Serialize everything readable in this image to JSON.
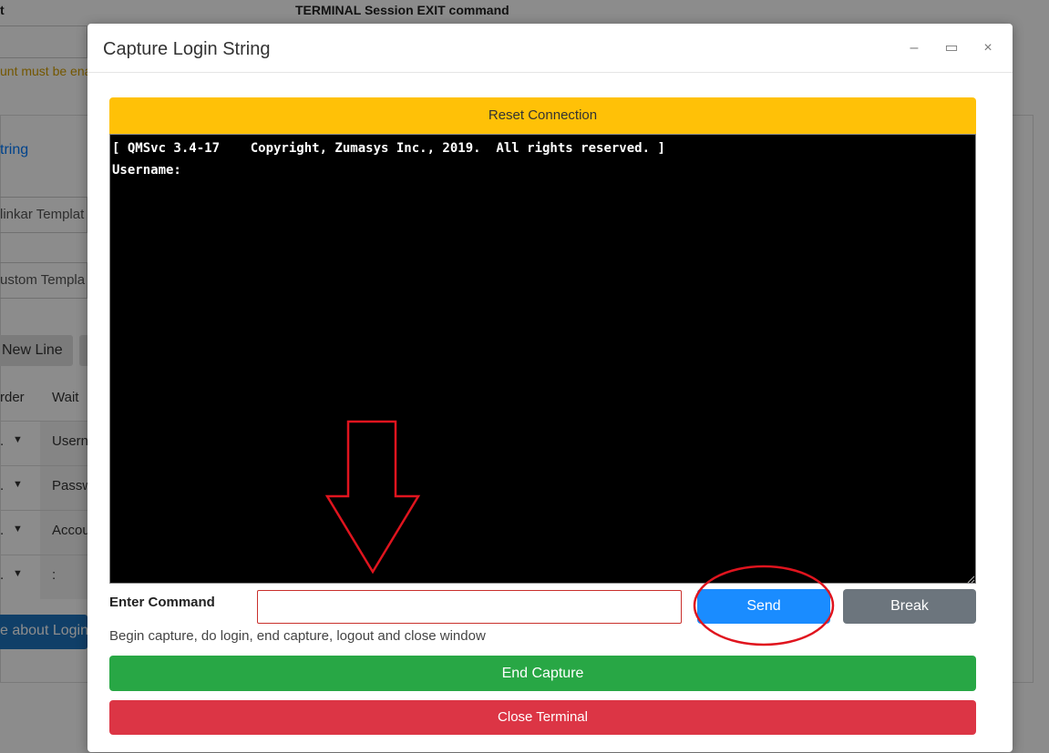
{
  "background": {
    "top_left_text": "t",
    "top_mid_text": "TERMINAL Session EXIT command",
    "warning_text": "unt must be ena",
    "link_text": "tring",
    "select_1": "linkar Templat",
    "select_2": "ustom Templa",
    "new_line_button": "New Line",
    "table_header_1": "rder",
    "table_header_2": "Wait",
    "rows": [
      {
        "cell": "Usern"
      },
      {
        "cell": "Passw"
      },
      {
        "cell": "Accou"
      },
      {
        "cell": ":"
      }
    ],
    "about_button": "e about Login"
  },
  "modal": {
    "title": "Capture Login String",
    "minimize_icon": "–",
    "maximize_icon": "▭",
    "close_icon": "×",
    "reset_button": "Reset Connection",
    "terminal_output": "[ QMSvc 3.4-17    Copyright, Zumasys Inc., 2019.  All rights reserved. ]\nUsername:",
    "command_label": "Enter Command",
    "command_value": "",
    "send_button": "Send",
    "break_button": "Break",
    "hint": "Begin capture, do login, end capture, logout and close window",
    "end_capture_button": "End Capture",
    "close_terminal_button": "Close Terminal"
  },
  "colors": {
    "reset": "#ffc107",
    "send": "#1a8cff",
    "break": "#6c757d",
    "end_capture": "#28a745",
    "close_terminal": "#dc3545",
    "annotation": "#e0141e"
  }
}
